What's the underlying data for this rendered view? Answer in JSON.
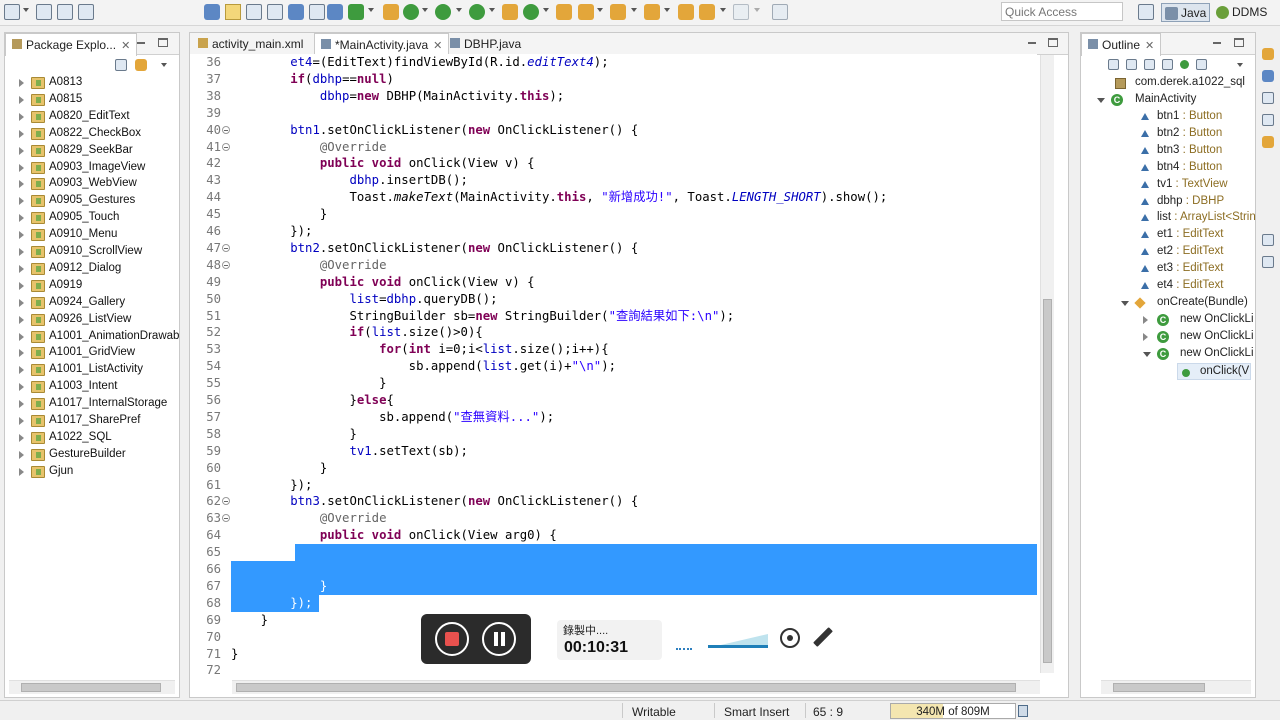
{
  "toolbar": {
    "quick_access": "Quick Access",
    "perspectives": [
      "Java",
      "DDMS"
    ]
  },
  "package_explorer": {
    "title": "Package Explo...",
    "projects": [
      "A0813",
      "A0815",
      "A0820_EditText",
      "A0822_CheckBox",
      "A0829_SeekBar",
      "A0903_ImageView",
      "A0903_WebView",
      "A0905_Gestures",
      "A0905_Touch",
      "A0910_Menu",
      "A0910_ScrollView",
      "A0912_Dialog",
      "A0919",
      "A0924_Gallery",
      "A0926_ListView",
      "A1001_AnimationDrawab",
      "A1001_GridView",
      "A1001_ListActivity",
      "A1003_Intent",
      "A1017_InternalStorage",
      "A1017_SharePref",
      "A1022_SQL",
      "GestureBuilder",
      "Gjun"
    ]
  },
  "editor": {
    "tabs": [
      "activity_main.xml",
      "*MainActivity.java",
      "DBHP.java"
    ],
    "active_tab": 1,
    "lines": [
      {
        "n": "36",
        "code": "        et4=(EditText)findViewById(R.id.editText4);"
      },
      {
        "n": "37",
        "code": "        if(dbhp==null)"
      },
      {
        "n": "38",
        "code": "            dbhp=new DBHP(MainActivity.this);"
      },
      {
        "n": "39",
        "code": ""
      },
      {
        "n": "40",
        "code": "        btn1.setOnClickListener(new OnClickListener() {"
      },
      {
        "n": "41",
        "code": "            @Override"
      },
      {
        "n": "42",
        "code": "            public void onClick(View v) {"
      },
      {
        "n": "43",
        "code": "                dbhp.insertDB();"
      },
      {
        "n": "44",
        "code": "                Toast.makeText(MainActivity.this, \"新增成功!\", Toast.LENGTH_SHORT).show();"
      },
      {
        "n": "45",
        "code": "            }"
      },
      {
        "n": "46",
        "code": "        });"
      },
      {
        "n": "47",
        "code": "        btn2.setOnClickListener(new OnClickListener() {"
      },
      {
        "n": "48",
        "code": "            @Override"
      },
      {
        "n": "49",
        "code": "            public void onClick(View v) {"
      },
      {
        "n": "50",
        "code": "                list=dbhp.queryDB();"
      },
      {
        "n": "51",
        "code": "                StringBuilder sb=new StringBuilder(\"查詢結果如下:\\n\");"
      },
      {
        "n": "52",
        "code": "                if(list.size()>0){"
      },
      {
        "n": "53",
        "code": "                    for(int i=0;i<list.size();i++){"
      },
      {
        "n": "54",
        "code": "                        sb.append(list.get(i)+\"\\n\");"
      },
      {
        "n": "55",
        "code": "                    }"
      },
      {
        "n": "56",
        "code": "                }else{"
      },
      {
        "n": "57",
        "code": "                    sb.append(\"查無資料...\");"
      },
      {
        "n": "58",
        "code": "                }"
      },
      {
        "n": "59",
        "code": "                tv1.setText(sb);"
      },
      {
        "n": "60",
        "code": "            }"
      },
      {
        "n": "61",
        "code": "        });"
      },
      {
        "n": "62",
        "code": "        btn3.setOnClickListener(new OnClickListener() {"
      },
      {
        "n": "63",
        "code": "            @Override"
      },
      {
        "n": "64",
        "code": "            public void onClick(View arg0) {"
      },
      {
        "n": "65",
        "code": "                "
      },
      {
        "n": "66",
        "code": ""
      },
      {
        "n": "67",
        "code": "            }"
      },
      {
        "n": "68",
        "code": "        });"
      },
      {
        "n": "69",
        "code": "    }"
      },
      {
        "n": "70",
        "code": ""
      },
      {
        "n": "71",
        "code": "}"
      },
      {
        "n": "72",
        "code": ""
      }
    ]
  },
  "outline": {
    "title": "Outline",
    "package": "com.derek.a1022_sql",
    "class": "MainActivity",
    "fields": [
      {
        "name": "btn1",
        "type": " : Button"
      },
      {
        "name": "btn2",
        "type": " : Button"
      },
      {
        "name": "btn3",
        "type": " : Button"
      },
      {
        "name": "btn4",
        "type": " : Button"
      },
      {
        "name": "tv1",
        "type": " : TextView"
      },
      {
        "name": "dbhp",
        "type": " : DBHP"
      },
      {
        "name": "list",
        "type": " : ArrayList<Strin"
      },
      {
        "name": "et1",
        "type": " : EditText"
      },
      {
        "name": "et2",
        "type": " : EditText"
      },
      {
        "name": "et3",
        "type": " : EditText"
      },
      {
        "name": "et4",
        "type": " : EditText"
      }
    ],
    "method": "onCreate(Bundle)",
    "children": [
      "new OnClickLi",
      "new OnClickLi",
      "new OnClickLi"
    ],
    "leaf": "onClick(V"
  },
  "statusbar": {
    "writable": "Writable",
    "insert_mode": "Smart Insert",
    "position": "65 : 9",
    "heap": "340M of 809M",
    "heap_used": 340,
    "heap_total": 809
  },
  "recorder": {
    "status": "錄製中....",
    "time": "00:10:31"
  }
}
